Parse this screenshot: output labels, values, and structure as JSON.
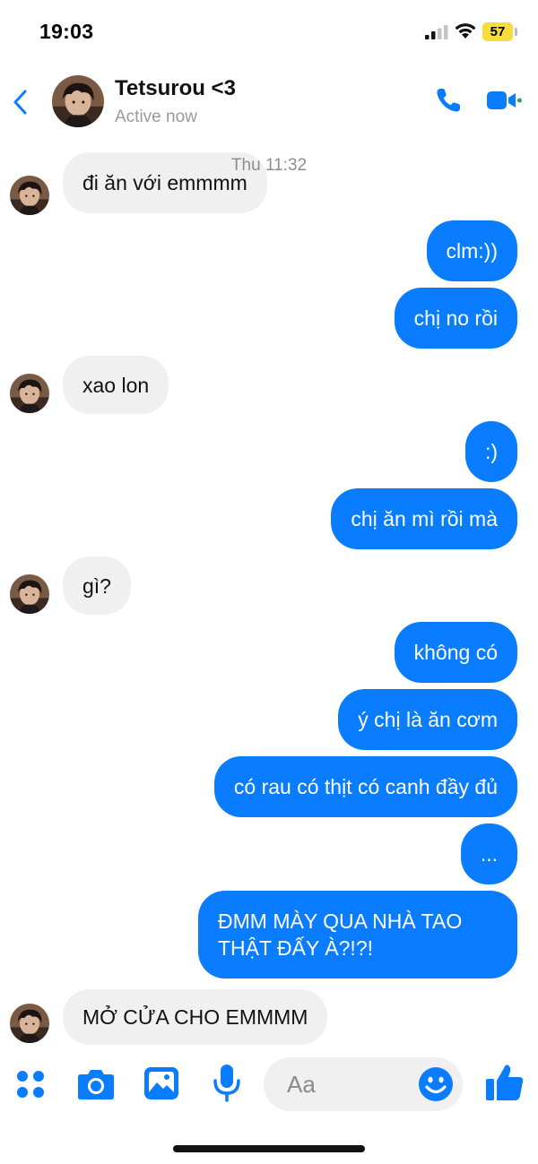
{
  "status_bar": {
    "time": "19:03",
    "battery": "57",
    "icons": [
      "signal-icon",
      "wifi-icon",
      "battery-icon"
    ]
  },
  "header": {
    "contact_name": "Tetsurou <3",
    "status": "Active now",
    "icons": [
      "back-chevron-icon",
      "phone-call-icon",
      "video-call-icon"
    ]
  },
  "chat": {
    "timestamp": "Thu 11:32",
    "messages": [
      {
        "sender": "contact",
        "text": "đi ăn với emmmm"
      },
      {
        "sender": "me",
        "text": "clm:))"
      },
      {
        "sender": "me",
        "text": "chị no rồi"
      },
      {
        "sender": "contact",
        "text": "xao lon"
      },
      {
        "sender": "me",
        "text": ":)"
      },
      {
        "sender": "me",
        "text": "chị ăn mì rồi mà"
      },
      {
        "sender": "contact",
        "text": "gì?"
      },
      {
        "sender": "me",
        "text": "không có"
      },
      {
        "sender": "me",
        "text": "ý chị là ăn cơm"
      },
      {
        "sender": "me",
        "text": "có rau có thịt có canh đầy đủ"
      },
      {
        "sender": "me",
        "text": "..."
      },
      {
        "sender": "me",
        "text": "ĐMM MÀY QUA NHÀ TAO THẬT ĐẤY À?!?!"
      },
      {
        "sender": "contact",
        "text": "MỞ CỬA CHO EMMMM"
      }
    ]
  },
  "composer": {
    "placeholder": "Aa",
    "icons": [
      "apps-grid-icon",
      "camera-icon",
      "photo-gallery-icon",
      "microphone-icon",
      "emoji-icon",
      "thumbs-up-icon"
    ]
  },
  "colors": {
    "accent": "#0a7cff",
    "incoming_bubble": "#f0f0f0",
    "active_dot": "#31a24c",
    "battery": "#f5dd3d"
  }
}
